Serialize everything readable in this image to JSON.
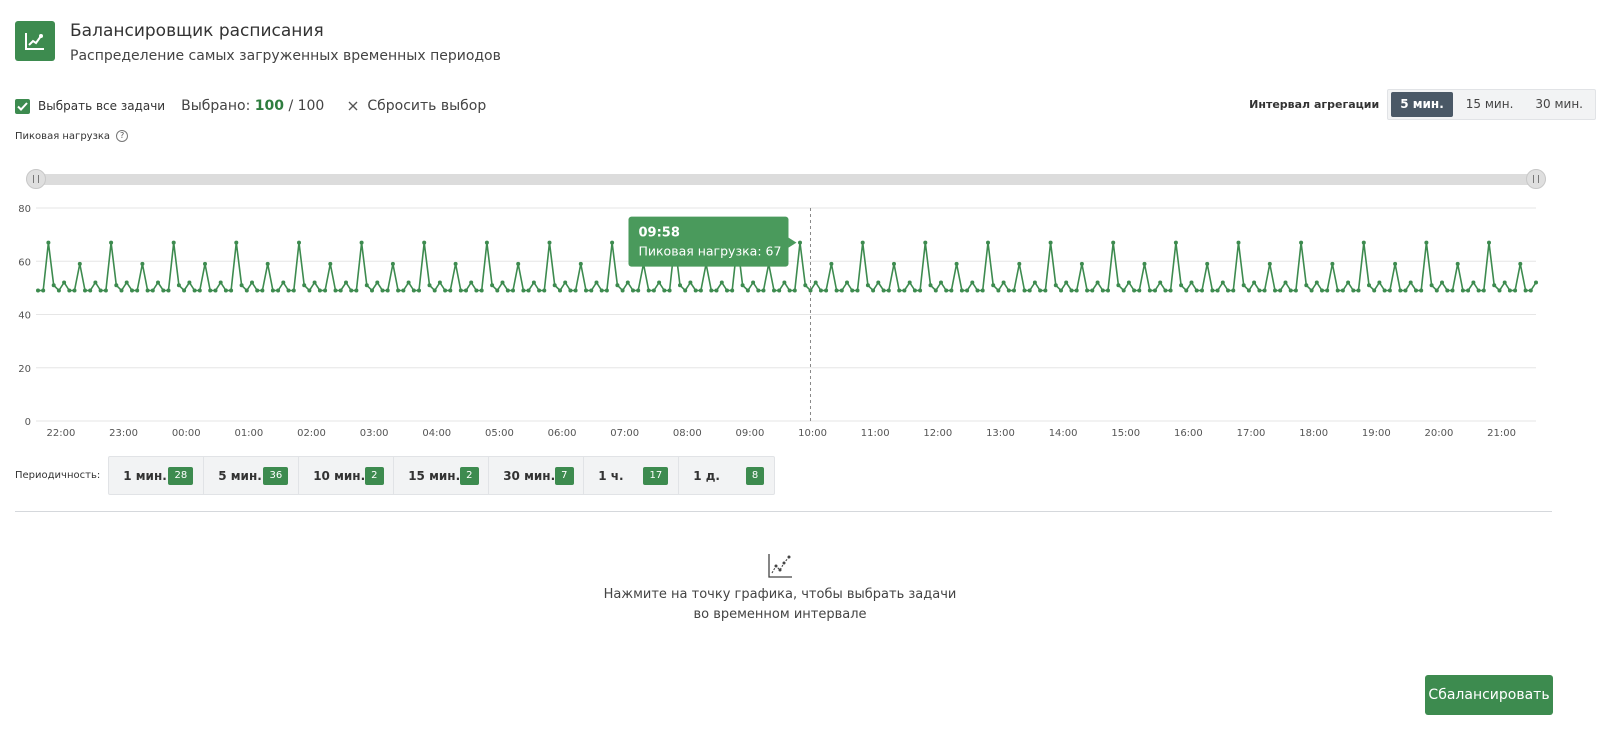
{
  "header": {
    "logo_icon": "line-chart-icon",
    "title": "Балансировщик расписания",
    "subtitle": "Распределение самых загруженных временных периодов"
  },
  "toolbar": {
    "select_all_label": "Выбрать все задачи",
    "selected_prefix": "Выбрано:",
    "selected_count": "100",
    "selected_total": "/ 100",
    "reset_label": "Сбросить выбор"
  },
  "aggregation": {
    "label": "Интервал агрегации",
    "options": [
      "5 мин.",
      "15 мин.",
      "30 мин."
    ],
    "selected": "5 мин."
  },
  "peak_load_label": "Пиковая нагрузка",
  "chart_data": {
    "type": "line",
    "interval_minutes": 5,
    "ylim": [
      0,
      80
    ],
    "yticks": [
      "0",
      "20",
      "40",
      "60",
      "80"
    ],
    "xticks": [
      "22:00",
      "23:00",
      "00:00",
      "01:00",
      "02:00",
      "03:00",
      "04:00",
      "05:00",
      "06:00",
      "07:00",
      "08:00",
      "09:00",
      "10:00",
      "11:00",
      "12:00",
      "13:00",
      "14:00",
      "15:00",
      "16:00",
      "17:00",
      "18:00",
      "19:00",
      "20:00",
      "21:00"
    ],
    "x_start": "21:38",
    "pattern": [
      49,
      49,
      67,
      51,
      49,
      52,
      49,
      49,
      59,
      49,
      49,
      52
    ],
    "length": 288,
    "line_color": "#3d8b4f",
    "grid": true,
    "tooltip": {
      "time": "09:58",
      "label": "Пиковая нагрузка: 67",
      "value": 67
    }
  },
  "periodicity": {
    "label": "Периодичность:",
    "items": [
      {
        "label": "1 мин.",
        "count": "28"
      },
      {
        "label": "5 мин.",
        "count": "36"
      },
      {
        "label": "10 мин.",
        "count": "2"
      },
      {
        "label": "15 мин.",
        "count": "2"
      },
      {
        "label": "30 мин.",
        "count": "7"
      },
      {
        "label": "1 ч.",
        "count": "17"
      },
      {
        "label": "1 д.",
        "count": "8"
      }
    ]
  },
  "empty_state": {
    "icon": "chart-points-icon",
    "line1": "Нажмите на точку графика, чтобы выбрать задачи",
    "line2": "во временном интервале"
  },
  "balance_button_label": "Сбалансировать"
}
